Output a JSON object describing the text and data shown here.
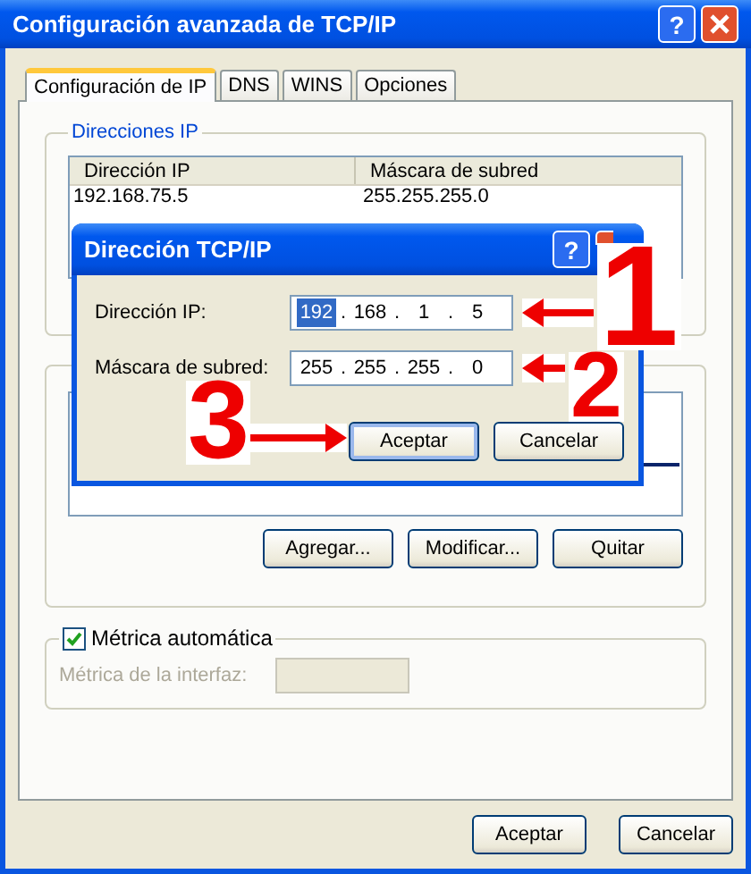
{
  "window": {
    "title": "Configuración avanzada de TCP/IP",
    "help": "?"
  },
  "tabs": [
    {
      "label": "Configuración de IP",
      "selected": true
    },
    {
      "label": "DNS",
      "selected": false
    },
    {
      "label": "WINS",
      "selected": false
    },
    {
      "label": "Opciones",
      "selected": false
    }
  ],
  "ip_addresses": {
    "title": "Direcciones IP",
    "columns": [
      "Dirección IP",
      "Máscara de subred"
    ],
    "rows": [
      [
        "192.168.75.5",
        "255.255.255.0"
      ]
    ]
  },
  "gateways": {
    "buttons": [
      "Agregar...",
      "Modificar...",
      "Quitar"
    ]
  },
  "metric": {
    "label": "Métrica automática",
    "checked": true,
    "interface_label": "Métrica de la interfaz:",
    "disabled": true
  },
  "buttons": [
    "Aceptar",
    "Cancelar"
  ],
  "dialog": {
    "title": "Dirección TCP/IP",
    "help": "?",
    "separator": ".",
    "fields": [
      {
        "label": "Dirección IP:",
        "octets": [
          {
            "text": "192",
            "selected": true
          },
          {
            "text": "168",
            "selected": false
          },
          {
            "text": "1",
            "selected": false
          },
          {
            "text": "5",
            "selected": false
          }
        ]
      },
      {
        "label": "Máscara de subred:",
        "octets": [
          {
            "text": "255",
            "selected": false
          },
          {
            "text": "255",
            "selected": false
          },
          {
            "text": "255",
            "selected": false
          },
          {
            "text": "0",
            "selected": false
          }
        ]
      }
    ],
    "buttons": [
      "Aceptar",
      "Cancelar"
    ]
  },
  "annotations": [
    {
      "label": "1",
      "kind": "left"
    },
    {
      "label": "2",
      "kind": "left"
    },
    {
      "label": "3",
      "kind": "right"
    }
  ]
}
